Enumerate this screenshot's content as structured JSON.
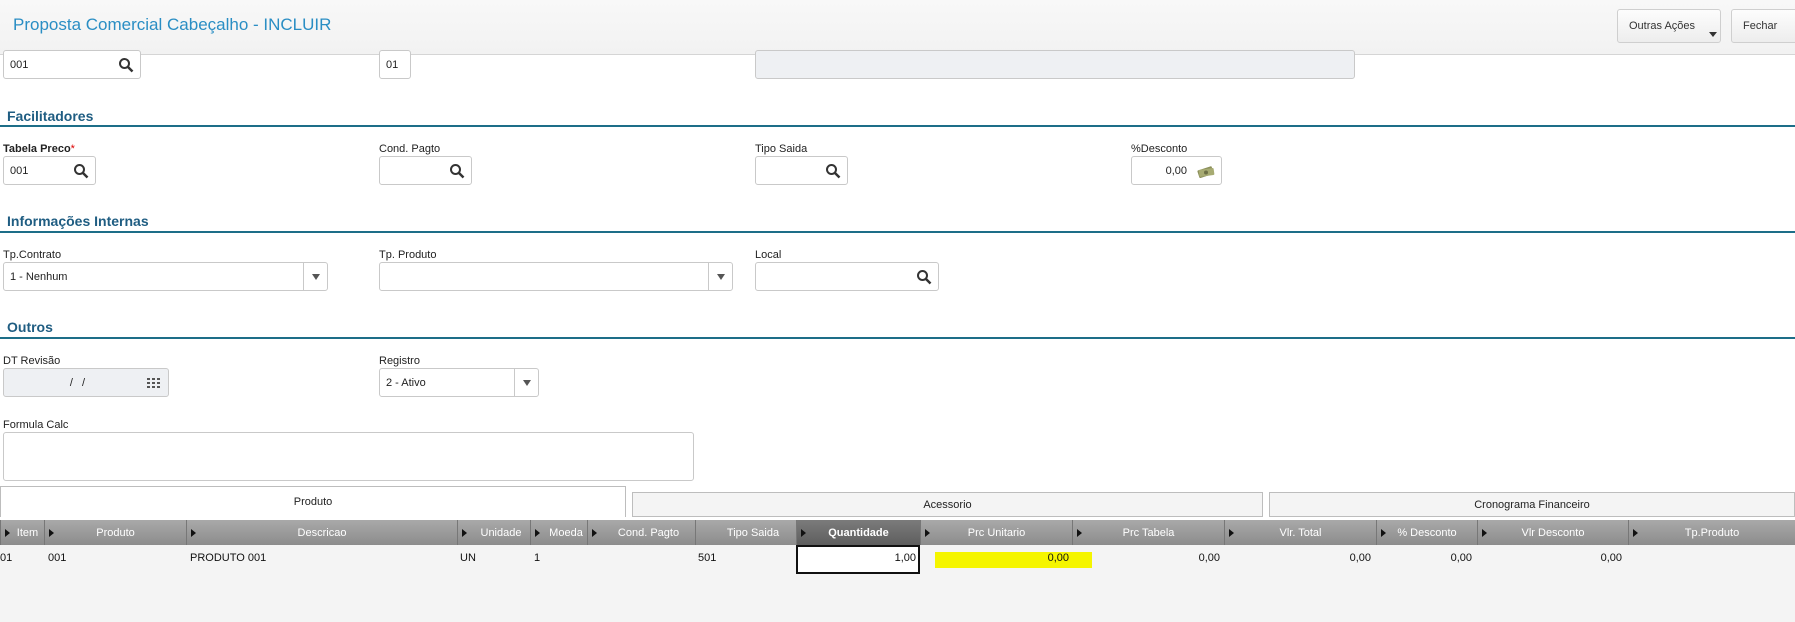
{
  "header": {
    "title": "Proposta Comercial Cabeçalho - INCLUIR",
    "outras_acoes": "Outras Ações",
    "fechar": "Fechar"
  },
  "top_fields": {
    "field1_value": "001",
    "field2_value": "01",
    "field3_value": ""
  },
  "facilitadores": {
    "title": "Facilitadores",
    "tabela_preco_label": "Tabela Preco",
    "tabela_preco_required": "*",
    "tabela_preco_value": "001",
    "cond_pagto_label": "Cond. Pagto",
    "cond_pagto_value": "",
    "tipo_saida_label": "Tipo Saida",
    "tipo_saida_value": "",
    "desconto_label": "%Desconto",
    "desconto_value": "0,00"
  },
  "info_internas": {
    "title": "Informações Internas",
    "tp_contrato_label": "Tp.Contrato",
    "tp_contrato_value": "1 - Nenhum",
    "tp_produto_label": "Tp. Produto",
    "tp_produto_value": "",
    "local_label": "Local",
    "local_value": ""
  },
  "outros": {
    "title": "Outros",
    "dt_revisao_label": "DT Revisão",
    "dt_revisao_value": "/  /",
    "registro_label": "Registro",
    "registro_value": "2 - Ativo",
    "formula_calc_label": "Formula Calc"
  },
  "tabs": [
    "Produto",
    "Acessorio",
    "Cronograma Financeiro"
  ],
  "grid": {
    "columns": [
      "Item",
      "Produto",
      "Descricao",
      "Unidade",
      "Moeda",
      "Cond. Pagto",
      "Tipo Saida",
      "Quantidade",
      "Prc Unitario",
      "Prc Tabela",
      "Vlr. Total",
      "% Desconto",
      "Vlr Desconto",
      "Tp.Produto"
    ],
    "row": {
      "item": "01",
      "produto": "001",
      "descricao": "PRODUTO 001",
      "unidade": "UN",
      "moeda": "1",
      "tipo_saida": "501",
      "quantidade": "1,00",
      "prc_unitario": "0,00",
      "prc_tabela": "0,00",
      "vlr_total": "0,00",
      "desconto": "0,00",
      "vlr_desconto": "0,00"
    }
  },
  "colors": {
    "title": "#2a8ec4",
    "section": "#1f5d82",
    "highlight": "#f5f500"
  }
}
